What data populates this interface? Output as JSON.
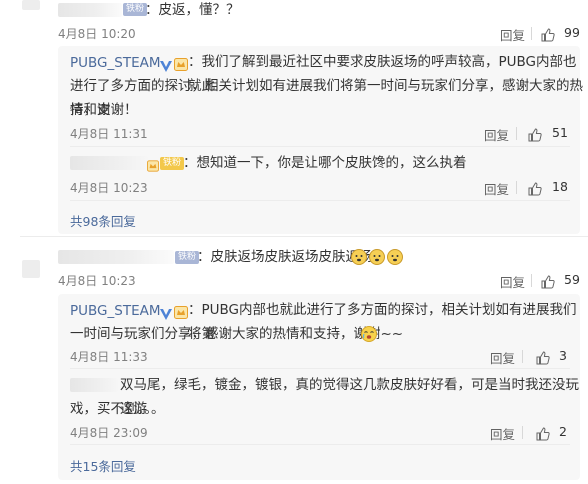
{
  "c1": {
    "badge": "铁粉",
    "text": "：皮返，懂？？",
    "date": "4月8日 10:20",
    "reply": "回复",
    "likes": "99"
  },
  "r1": {
    "name": "PUBG_STEAM",
    "text_line1": "：我们了解到最近社区中要求皮肤返场的呼声较高，PUBG内部也就此",
    "text_line2": "进行了多方面的探讨，相关计划如有进展我们将第一时间与玩家们分享，感谢大家的热情和支",
    "text_line3": "持，谢谢！",
    "date": "4月8日 11:31",
    "reply": "回复",
    "likes": "51"
  },
  "r2": {
    "badge": "铁粉",
    "text": "：想知道一下，你是让哪个皮肤馋的，这么执着",
    "date": "4月8日 10:23",
    "reply": "回复",
    "likes": "18"
  },
  "more1": "共98条回复",
  "c2": {
    "badge": "铁粉",
    "text": "：皮肤返场皮肤返场皮肤返场",
    "date": "4月8日 10:23",
    "reply": "回复",
    "likes": "59"
  },
  "r3": {
    "name": "PUBG_STEAM",
    "text_line1": "：PUBG内部也就此进行了多方面的探讨，相关计划如有进展我们将第",
    "text_line2": "一时间与玩家们分享，感谢大家的热情和支持，谢谢~~",
    "date": "4月8日 11:33",
    "reply": "回复",
    "likes": "3"
  },
  "r4": {
    "text_line1": "双马尾，绿毛，镀金，镀银，真的觉得这几款皮肤好好看，可是当时我还没玩这游",
    "text_line2": "戏，买不到。。。",
    "date": "4月8日 23:09",
    "reply": "回复",
    "likes": "2"
  },
  "more2": "共15条回复",
  "colors": {
    "link": "#4b6a9b",
    "muted": "#808080",
    "reply_bg": "#f7f7f7"
  }
}
